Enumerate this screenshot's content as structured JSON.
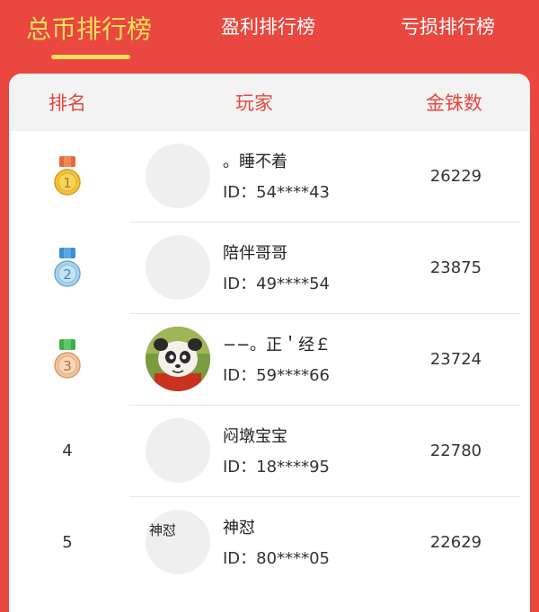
{
  "tabs": [
    {
      "label": "总币排行榜",
      "active": true
    },
    {
      "label": "盈利排行榜",
      "active": false
    },
    {
      "label": "亏损排行榜",
      "active": false
    }
  ],
  "table": {
    "headers": [
      "排名",
      "玩家",
      "金铢数"
    ],
    "rows": [
      {
        "rank": "1",
        "medal": "gold-medal-icon",
        "name": "。睡不着",
        "id": "ID：54****43",
        "coins": "26229",
        "avatar": "placeholder"
      },
      {
        "rank": "2",
        "medal": "silver-medal-icon",
        "name": "陪伴哥哥",
        "id": "ID：49****54",
        "coins": "23875",
        "avatar": "placeholder"
      },
      {
        "rank": "3",
        "medal": "bronze-medal-icon",
        "name": "−−。正＇经￡",
        "id": "ID：59****66",
        "coins": "23724",
        "avatar": "panda-avatar"
      },
      {
        "rank": "4",
        "medal": "",
        "name": "闷墩宝宝",
        "id": "ID：18****95",
        "coins": "22780",
        "avatar": "placeholder"
      },
      {
        "rank": "5",
        "medal": "",
        "name": "神怼",
        "id": "ID：80****05",
        "coins": "22629",
        "avatar": "placeholder",
        "avatar_text": "神怼"
      }
    ]
  },
  "colors": {
    "background": "#e9473f",
    "active_tab": "#fde05a",
    "header_text": "#e9473f",
    "gold_medal": "#f2c43b",
    "silver_medal": "#a9d4ef",
    "bronze_medal": "#f3c39c"
  }
}
